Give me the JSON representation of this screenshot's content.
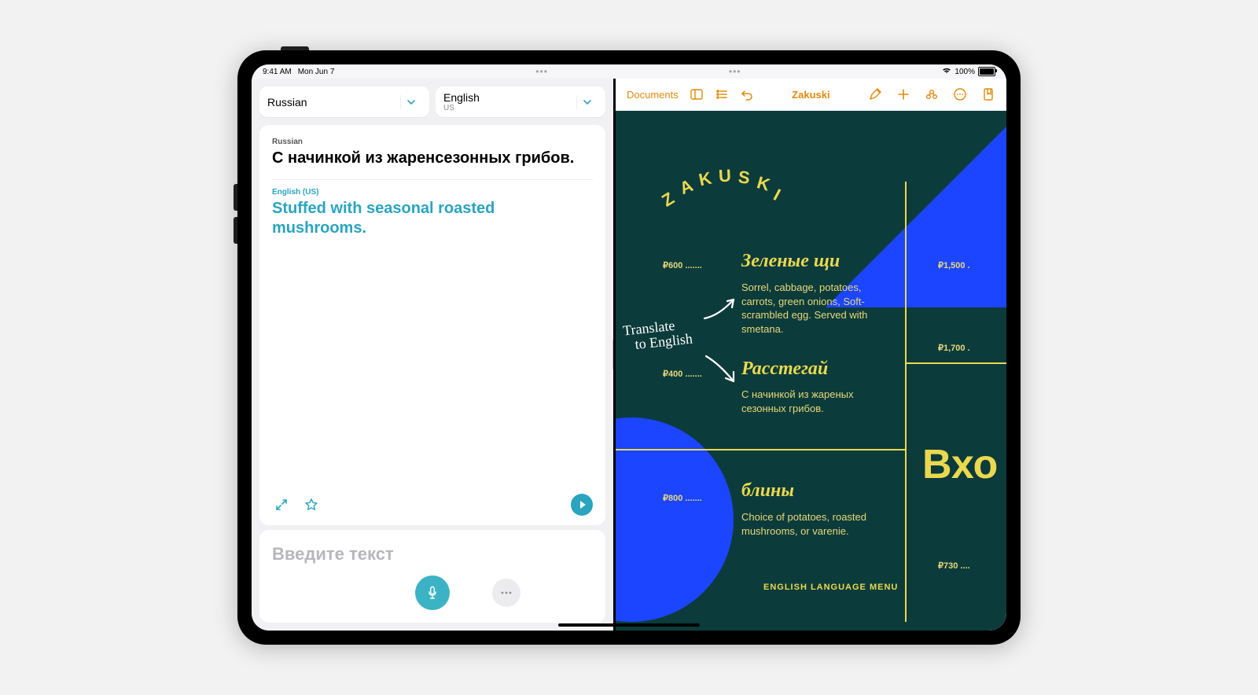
{
  "status": {
    "time": "9:41 AM",
    "date": "Mon Jun 7",
    "battery_pct": "100%"
  },
  "translate": {
    "source_lang_label": "Russian",
    "target_lang_label": "English",
    "target_lang_sub": "US",
    "card": {
      "src_lang": "Russian",
      "src_text": "С начинкой из жаренсезонных грибов.",
      "tgt_lang": "English (US)",
      "tgt_text": "Stuffed with seasonal roasted mushrooms."
    },
    "input_placeholder": "Введите текст"
  },
  "notes": {
    "back_label": "Documents",
    "doc_title": "Zakuski",
    "handwriting_line1": "Translate",
    "handwriting_line2": "to English",
    "menu": {
      "brand": "ZAKUSKI",
      "dish1": {
        "title": "Зеленые щи",
        "price": "₽600 .......",
        "desc": "Sorrel, cabbage, potatoes, carrots, green onions, Soft-scrambled egg. Served with smetana."
      },
      "dish2": {
        "title": "Расстегай",
        "price": "₽400 .......",
        "desc": "С начинкой из жареных сезонных грибов."
      },
      "dish3": {
        "title": "блины",
        "price": "₽800 .......",
        "desc": "Choice of potatoes, roasted mushrooms, or varenie."
      },
      "side_heading": "Вхо",
      "price_r1": "₽1,500 .",
      "price_r2": "₽1,700 .",
      "price_r3": "₽730 ....",
      "footer": "ENGLISH LANGUAGE MENU"
    }
  }
}
